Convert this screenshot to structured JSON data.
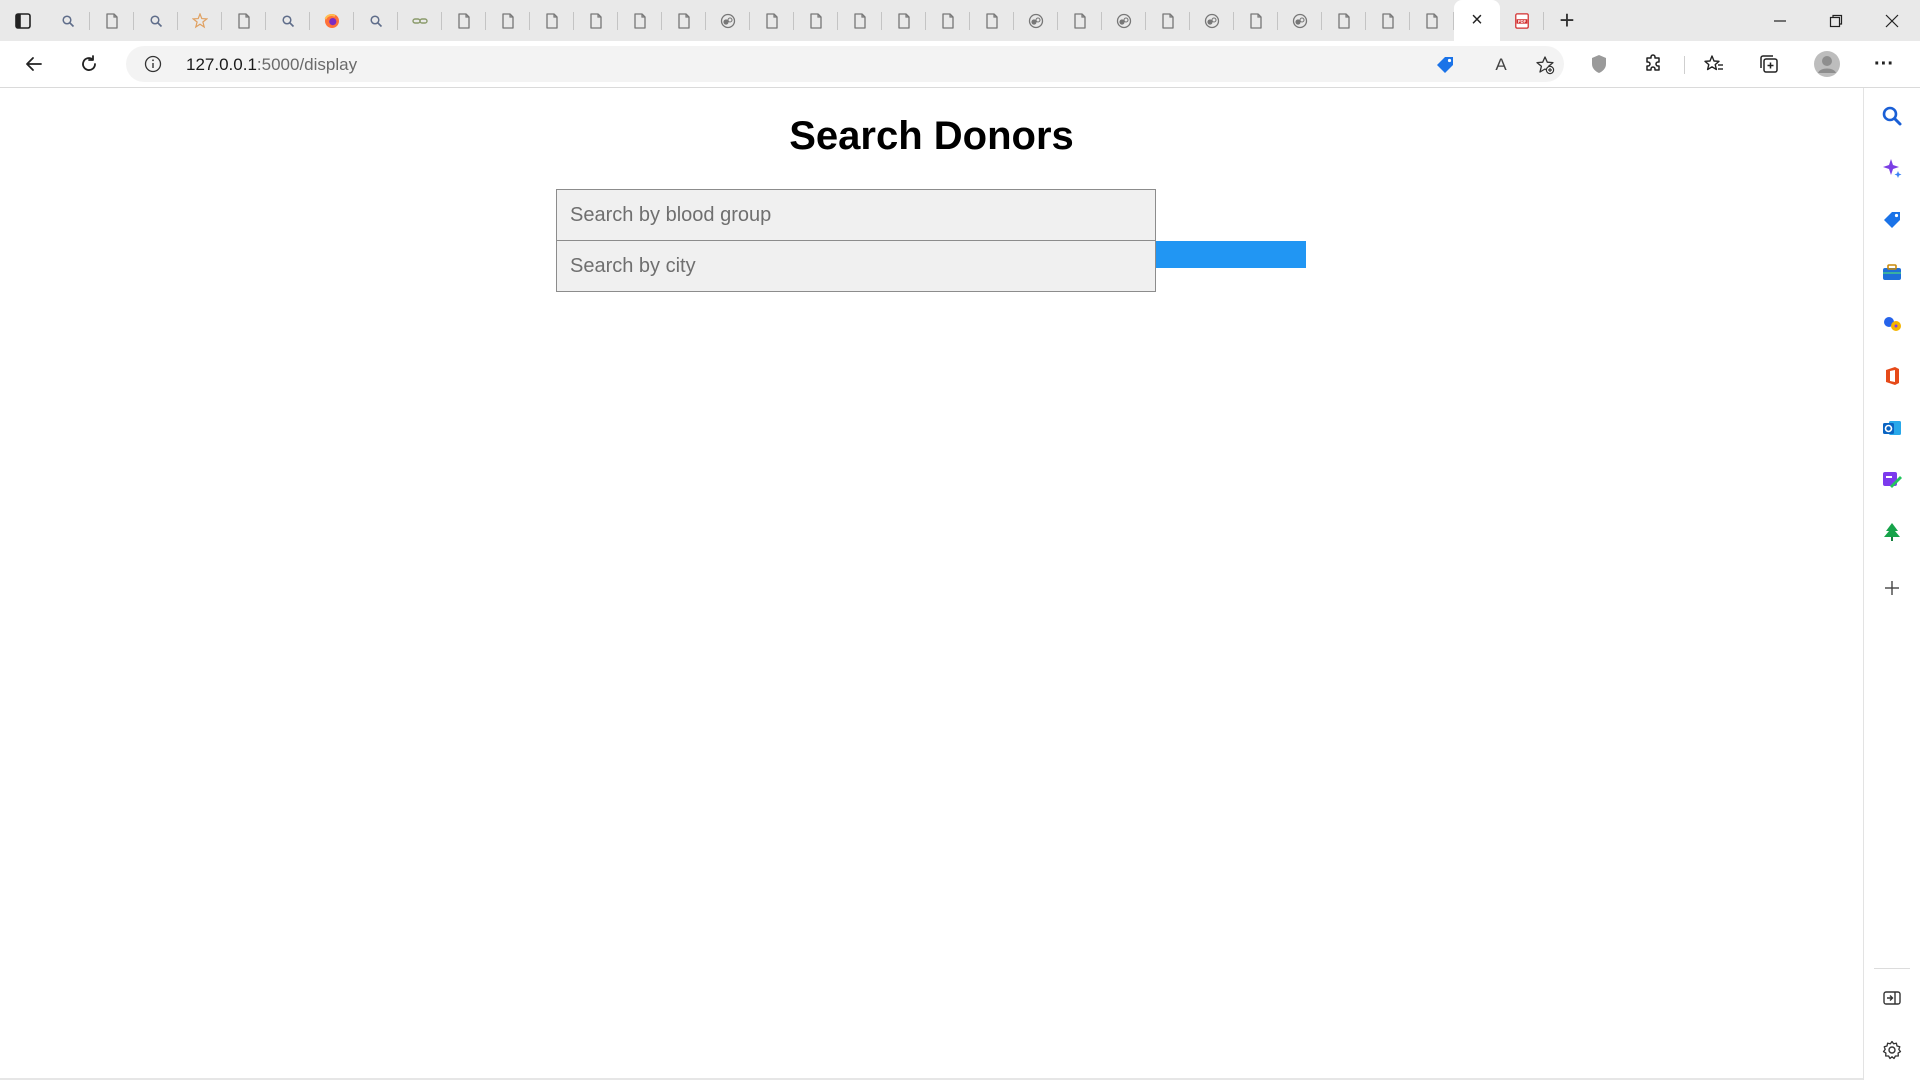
{
  "browser": {
    "tab_count": 35,
    "active_tab_close": "×",
    "new_tab": "+",
    "window_controls": {
      "minimize": "–",
      "maximize": "❐",
      "close": "✕"
    },
    "address": {
      "host": "127.0.0.1",
      "path": ":5000/display"
    },
    "read_aloud": "A",
    "more_menu": "···"
  },
  "page": {
    "title": "Search Donors",
    "blood_group_placeholder": "Search by blood group",
    "city_placeholder": "Search by city",
    "search_button_label": ""
  },
  "colors": {
    "accent_button": "#2196f3",
    "tab_strip": "#e9e9e9",
    "input_bg": "#f0f0f0"
  },
  "icons": {
    "tabs": [
      "tab-actions-icon",
      "search-favicon",
      "page-favicon",
      "search-favicon",
      "star-favicon",
      "page-favicon",
      "search-favicon",
      "firefox-favicon",
      "search-favicon",
      "link-favicon",
      "page-favicon",
      "page-favicon",
      "page-favicon",
      "page-favicon",
      "page-favicon",
      "page-favicon",
      "github-favicon",
      "page-favicon",
      "page-favicon",
      "page-favicon",
      "page-favicon",
      "page-favicon",
      "page-favicon",
      "github-favicon",
      "page-favicon",
      "github-favicon",
      "page-favicon",
      "github-favicon",
      "page-favicon",
      "github-favicon",
      "page-favicon",
      "page-favicon",
      "page-favicon",
      "page-favicon",
      "pdf-favicon"
    ],
    "sidebar": [
      "search-icon",
      "copilot-icon",
      "shopping-tag-icon",
      "tools-icon",
      "games-icon",
      "office-icon",
      "outlook-icon",
      "designer-icon",
      "tree-icon",
      "add-icon",
      "panel-icon",
      "settings-icon"
    ]
  }
}
